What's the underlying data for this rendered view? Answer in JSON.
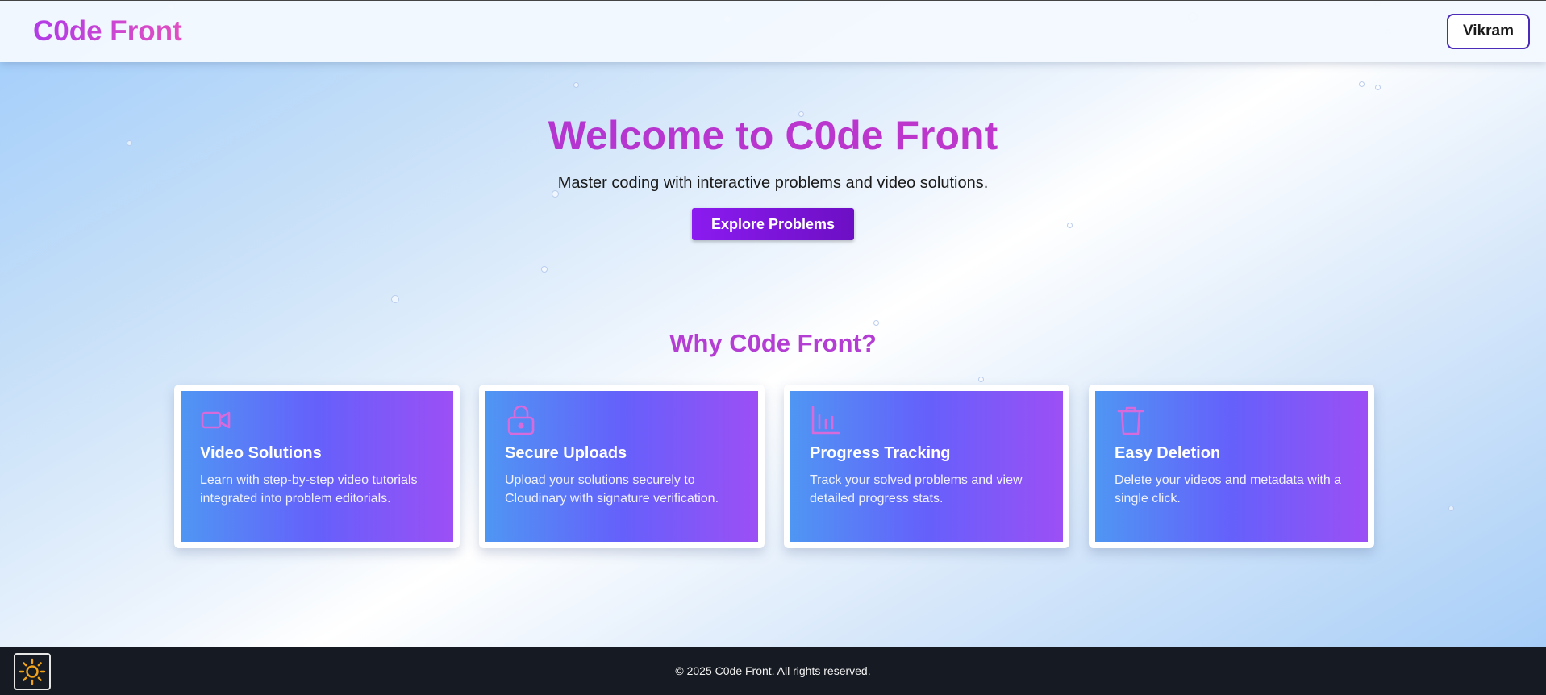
{
  "header": {
    "logo": "C0de Front",
    "user_label": "Vikram"
  },
  "hero": {
    "title": "Welcome to C0de Front",
    "subtitle": "Master coding with interactive problems and video solutions.",
    "cta_label": "Explore Problems"
  },
  "features": {
    "heading": "Why C0de Front?",
    "items": [
      {
        "icon": "video-camera-icon",
        "title": "Video Solutions",
        "text": "Learn with step-by-step video tutorials integrated into problem editorials."
      },
      {
        "icon": "lock-icon",
        "title": "Secure Uploads",
        "text": "Upload your solutions securely to Cloudinary with signature verification."
      },
      {
        "icon": "bar-chart-icon",
        "title": "Progress Tracking",
        "text": "Track your solved problems and view detailed progress stats."
      },
      {
        "icon": "trash-icon",
        "title": "Easy Deletion",
        "text": "Delete your videos and metadata with a single click."
      }
    ]
  },
  "footer": {
    "copyright": "© 2025 C0de Front. All rights reserved."
  },
  "theme_toggle": {
    "icon": "sun-icon"
  },
  "colors": {
    "brand_gradient_start": "#b13be6",
    "brand_gradient_end": "#e14fc0",
    "cta": "#8b1bf0",
    "card_gradient_start": "#4f96f3",
    "card_gradient_end": "#9c4ff5",
    "footer_bg": "#161a22"
  }
}
